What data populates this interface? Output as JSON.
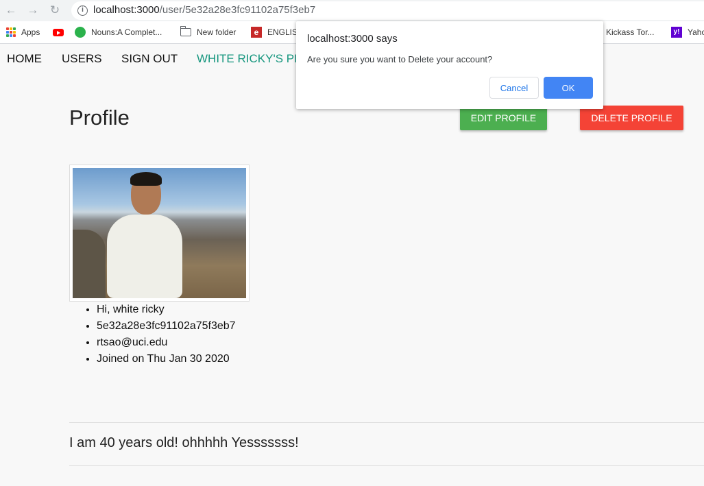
{
  "browser": {
    "url_host": "localhost:3000",
    "url_path": "/user/5e32a28e3fc91102a75f3eb7",
    "bookmarks": [
      {
        "label": "Apps",
        "icon": "apps-grid-icon"
      },
      {
        "label": "",
        "icon": "youtube-icon"
      },
      {
        "label": "Nouns:A Complet...",
        "icon": "green-circle-icon"
      },
      {
        "label": "New folder",
        "icon": "folder-icon"
      },
      {
        "label": "ENGLIS",
        "icon": "e-icon"
      },
      {
        "label": "Kickass Tor...",
        "icon": ""
      },
      {
        "label": "Yaho",
        "icon": "yahoo-icon"
      }
    ]
  },
  "nav": {
    "home": "HOME",
    "users": "USERS",
    "sign_out": "SIGN OUT",
    "profile_link": "WHITE RICKY'S PR",
    "active_color": "#16967e"
  },
  "profile": {
    "title": "Profile",
    "edit_label": "EDIT PROFILE",
    "delete_label": "DELETE PROFILE",
    "edit_color": "#4caf50",
    "delete_color": "#f44336",
    "details": [
      "Hi, white ricky",
      "5e32a28e3fc91102a75f3eb7",
      "rtsao@uci.edu",
      "Joined on Thu Jan 30 2020"
    ],
    "bio": "I am 40 years old! ohhhhh Yesssssss!"
  },
  "dialog": {
    "title": "localhost:3000 says",
    "message": "Are you sure you want to Delete your account?",
    "cancel": "Cancel",
    "ok": "OK"
  }
}
